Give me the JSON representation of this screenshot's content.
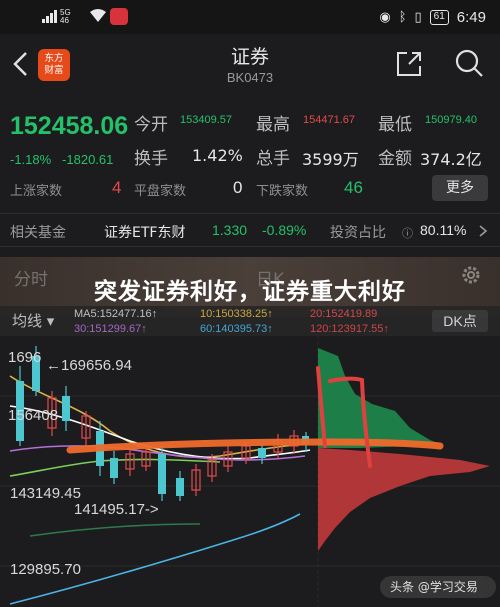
{
  "statusbar": {
    "network": "5G\n46",
    "battery": "61",
    "time": "6:49",
    "icons": [
      "signal-icon",
      "wifi-icon",
      "app-notification-icon",
      "eye-icon",
      "bluetooth-icon",
      "vibrate-icon",
      "battery-icon"
    ]
  },
  "header": {
    "logo_line1": "东方",
    "logo_line2": "财富",
    "title": "证券",
    "code": "BK0473"
  },
  "quote": {
    "price": "152458.06",
    "change_pct": "-1.18%",
    "change_amt": "-1820.61",
    "open_label": "今开",
    "open_value": "153409.57",
    "high_label": "最高",
    "high_value": "154471.67",
    "low_label": "最低",
    "low_value": "150979.40",
    "turnover_label": "换手",
    "turnover_value": "1.42%",
    "volume_label": "总手",
    "volume_value": "3599万",
    "amount_label": "金额",
    "amount_value": "374.2亿",
    "up_label": "上涨家数",
    "up_value": "4",
    "flat_label": "平盘家数",
    "flat_value": "0",
    "down_label": "下跌家数",
    "down_value": "46",
    "more_label": "更多"
  },
  "fund": {
    "label": "相关基金",
    "name": "证券ETF东财",
    "price": "1.330",
    "change": "-0.89%",
    "weight_label": "投资占比",
    "weight_value": "80.11%"
  },
  "banner": {
    "headline": "突发证券利好，证券重大利好",
    "tab_faint_1": "分时",
    "tab_faint_2": "日K"
  },
  "chartbar": {
    "ma_button": "均线",
    "ma5": "MA5:152477.16",
    "ma10": "10:150338.25",
    "ma20": "20:152419.89",
    "ma30": "30:151299.67",
    "ma60": "60:140395.73",
    "ma120": "120:123917.55",
    "dk_button": "DK点"
  },
  "chart": {
    "label_high": "169656.94",
    "label_axis_top": "1696",
    "label_axis_mid": "156408",
    "label_low": "141495.17",
    "axis_1": "143149.45",
    "axis_2": "129895.70",
    "annot_high": "←169656.94",
    "annot_low": "141495.17->"
  },
  "watermark": "头条 @学习交易",
  "colors": {
    "up": "#e24b4b",
    "down": "#24c06a",
    "background": "#1c1c1e"
  }
}
